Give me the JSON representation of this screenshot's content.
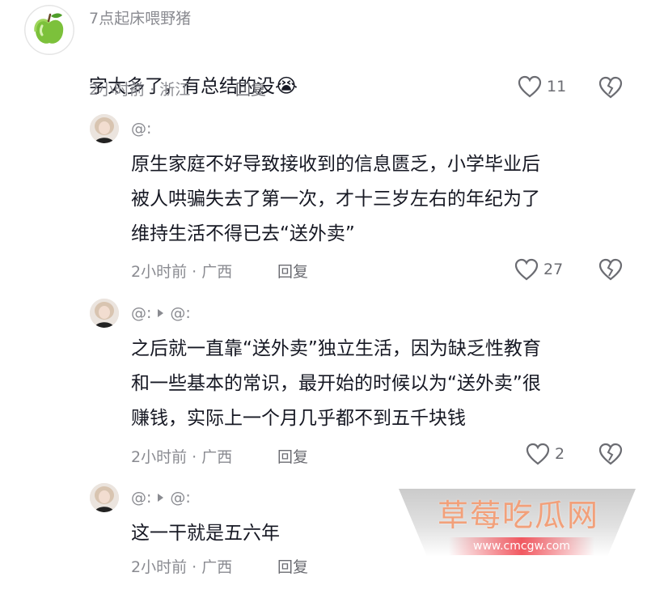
{
  "comments": {
    "c1": {
      "username": "7点起床喂野猪",
      "text": "字太多了，有总结的没",
      "emoji": "😭",
      "meta": "2小时前 · 浙江",
      "reply": "回复",
      "likes": "11"
    },
    "c2": {
      "username": "@:",
      "text": "原生家庭不好导致接收到的信息匮乏，小学毕业后\n被人哄骗失去了第一次，才十三岁左右的年纪为了\n维持生活不得已去“送外卖”",
      "meta": "2小时前 · 广西",
      "reply": "回复",
      "likes": "27"
    },
    "c3": {
      "username_from": "@:",
      "username_to": "@:",
      "text": "之后就一直靠“送外卖”独立生活，因为缺乏性教育\n和一些基本的常识，最开始的时候以为“送外卖”很\n赚钱，实际上一个月几乎都不到五千块钱",
      "meta": "2小时前 · 广西",
      "reply": "回复",
      "likes": "2"
    },
    "c4": {
      "username_from": "@:",
      "username_to": "@:",
      "text": "这一干就是五六年",
      "meta": "2小时前 · 广西",
      "reply": "回复"
    }
  },
  "watermark": {
    "title": "草莓吃瓜网",
    "url": "www.cmcgw.com"
  },
  "colors": {
    "text": "#161823",
    "muted": "#8a8b91",
    "apple": "#7cc13b",
    "watermark": "#f2a07a"
  }
}
